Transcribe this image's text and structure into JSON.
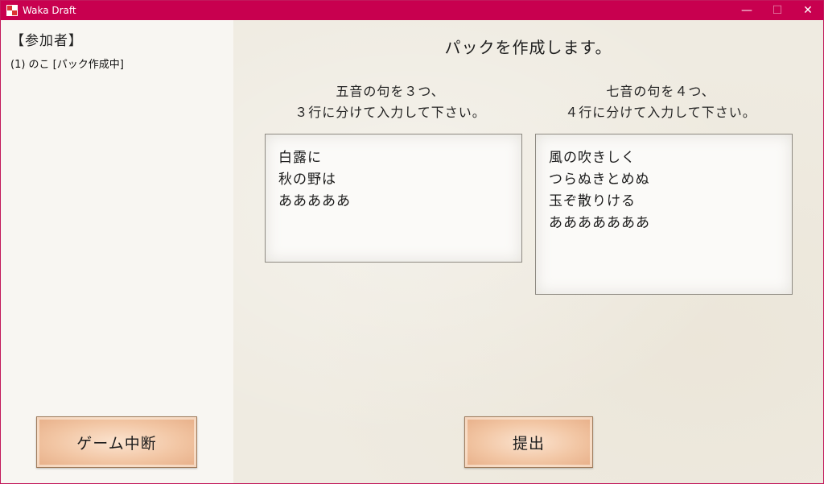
{
  "window": {
    "title": "Waka Draft",
    "minimize_glyph": "—",
    "maximize_glyph": "☐",
    "close_glyph": "✕"
  },
  "sidebar": {
    "title": "【参加者】",
    "participants": [
      {
        "label": "(1) のこ [パック作成中]"
      }
    ]
  },
  "main": {
    "heading": "パックを作成します。",
    "five": {
      "instruction_line1": "五音の句を３つ、",
      "instruction_line2": "３行に分けて入力して下さい。",
      "lines": [
        "白露に",
        "秋の野は",
        "あああああ"
      ]
    },
    "seven": {
      "instruction_line1": "七音の句を４つ、",
      "instruction_line2": "４行に分けて入力して下さい。",
      "lines": [
        "風の吹きしく",
        "つらぬきとめぬ",
        "玉ぞ散りける",
        "あああああああ"
      ]
    }
  },
  "buttons": {
    "abort_label": "ゲーム中断",
    "submit_label": "提出"
  },
  "colors": {
    "titlebar": "#c8004f",
    "button_fill": "#f2c6a4",
    "paper": "#efebe1"
  }
}
